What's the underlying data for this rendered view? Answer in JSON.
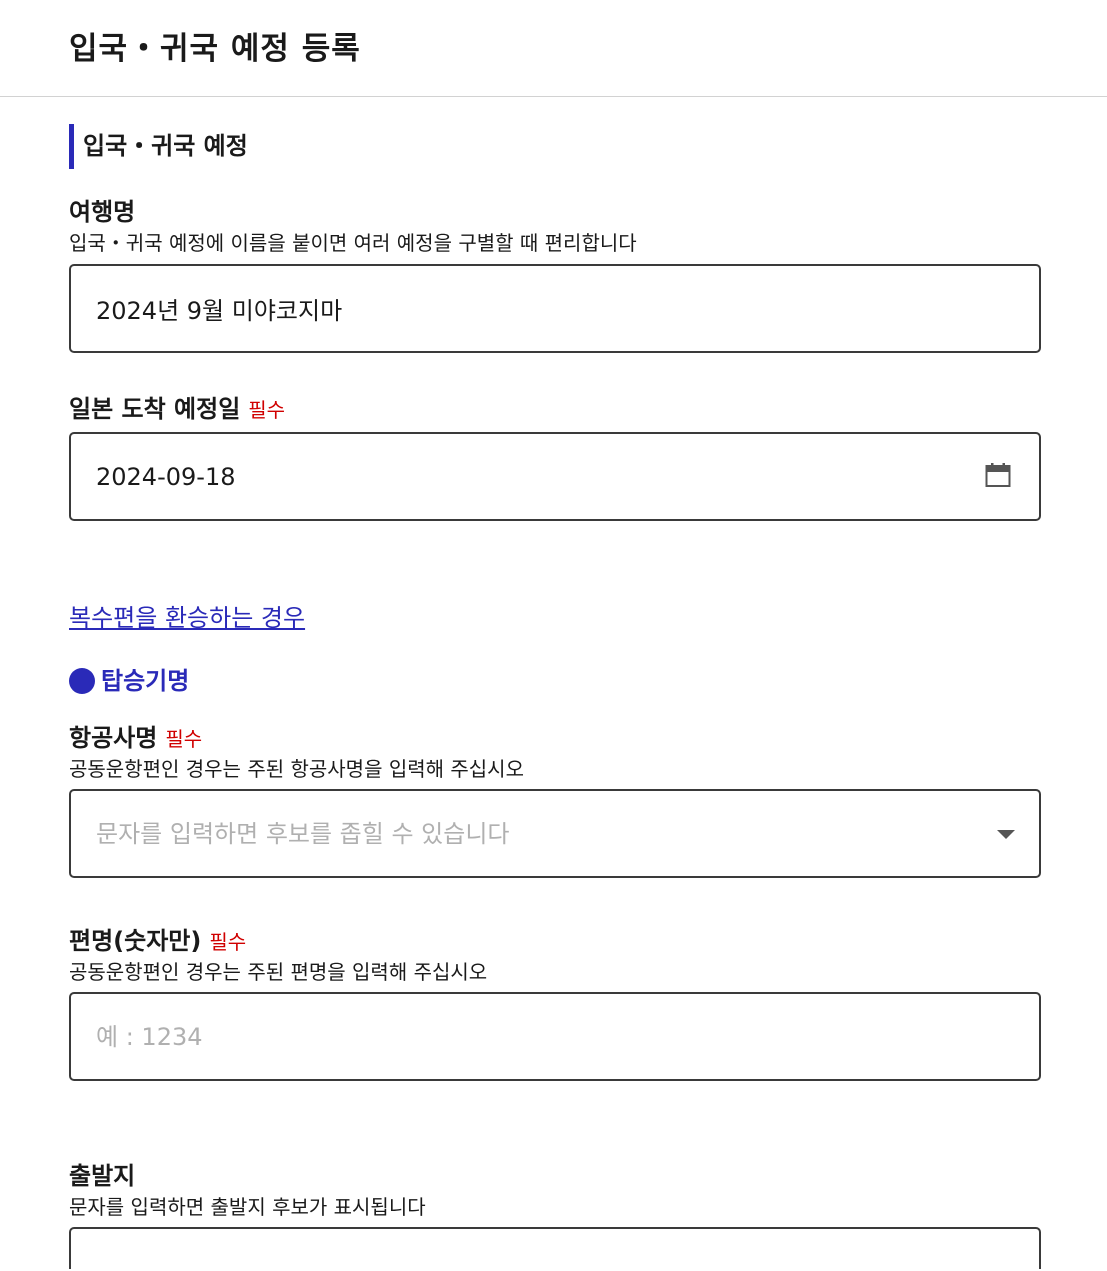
{
  "header": {
    "title": "입국・귀국 예정 등록"
  },
  "section": {
    "title": "입국・귀국 예정"
  },
  "trip_name": {
    "label": "여행명",
    "helper": "입국・귀국 예정에 이름을 붙이면 여러 예정을 구별할 때 편리합니다",
    "value": "2024년 9월 미야코지마"
  },
  "arrival_date": {
    "label": "일본 도착 예정일",
    "required": "필수",
    "value": "2024-09-18",
    "icon": "calendar-icon"
  },
  "transfer_link": "복수편을 환승하는 경우",
  "flight_section": {
    "title": "탑승기명"
  },
  "airline": {
    "label": "항공사명",
    "required": "필수",
    "helper": "공동운항편인 경우는 주된 항공사명을 입력해 주십시오",
    "placeholder": "문자를 입력하면 후보를 좁힐 수 있습니다",
    "icon": "chevron-down-icon"
  },
  "flight_number": {
    "label": "편명(숫자만)",
    "required": "필수",
    "helper": "공동운항편인 경우는 주된 편명을 입력해 주십시오",
    "placeholder": "예 : 1234"
  },
  "departure": {
    "label": "출발지",
    "helper": "문자를 입력하면 출발지 후보가 표시됩니다",
    "value": ""
  },
  "colors": {
    "accent": "#2a2ab8",
    "required": "#d00000",
    "border": "#3a3a3a"
  }
}
